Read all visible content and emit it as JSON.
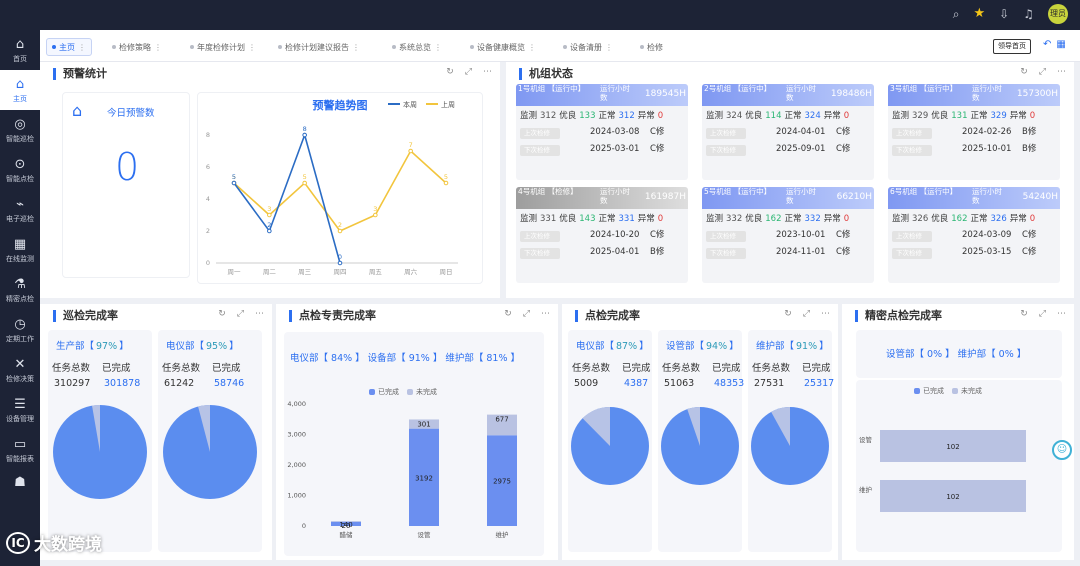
{
  "topbar": {
    "icons": [
      "search-icon",
      "star-icon",
      "download-icon",
      "bell-icon"
    ],
    "avatar_text": "理员"
  },
  "sidebar": {
    "items": [
      {
        "label": "首页",
        "icon": "home-icon",
        "glyph": "⌂"
      },
      {
        "label": "主页",
        "icon": "home-filled-icon",
        "glyph": "⌂",
        "active": true
      },
      {
        "label": "智能巡检",
        "icon": "patrol-icon",
        "glyph": "◎"
      },
      {
        "label": "智能点检",
        "icon": "spot-check-icon",
        "glyph": "⊙"
      },
      {
        "label": "电子巡检",
        "icon": "pulse-icon",
        "glyph": "⌁"
      },
      {
        "label": "在线监测",
        "icon": "monitor-icon",
        "glyph": "▦"
      },
      {
        "label": "精密点检",
        "icon": "precision-icon",
        "glyph": "⚗"
      },
      {
        "label": "定期工作",
        "icon": "clock-icon",
        "glyph": "◷"
      },
      {
        "label": "检修决策",
        "icon": "wrench-icon",
        "glyph": "✕"
      },
      {
        "label": "设备管理",
        "icon": "device-icon",
        "glyph": "☰"
      },
      {
        "label": "智能报表",
        "icon": "report-icon",
        "glyph": "▭"
      },
      {
        "label": "",
        "icon": "gamepad-icon",
        "glyph": "☗"
      }
    ]
  },
  "tabs": [
    {
      "label": "主页",
      "active": true
    },
    {
      "label": "检修策略"
    },
    {
      "label": "年度检修计划"
    },
    {
      "label": "检修计划建议报告"
    },
    {
      "label": "系统总览"
    },
    {
      "label": "设备健康概览"
    },
    {
      "label": "设备清册"
    },
    {
      "label": "检修"
    }
  ],
  "leader_button": "领导首页",
  "colors": {
    "accent": "#2c6ff0",
    "sidebar_bg": "#1d2336",
    "this_week": "#2b6cc4",
    "last_week": "#f2c53d",
    "done": "#6b8ff0",
    "undone": "#b9c2e2"
  },
  "alarm": {
    "title": "预警统计",
    "today_label": "今日预警数",
    "today_value": "0",
    "trend_title": "预警趋势图",
    "legend_this_week": "本周",
    "legend_last_week": "上周"
  },
  "chart_data": [
    {
      "type": "line",
      "title": "预警趋势图",
      "categories": [
        "周一",
        "周二",
        "周三",
        "周四",
        "周五",
        "周六",
        "周日"
      ],
      "ylim": [
        0,
        8
      ],
      "yticks": [
        0,
        2,
        4,
        6,
        8
      ],
      "series": [
        {
          "name": "本周",
          "values": [
            5,
            2,
            8,
            0,
            null,
            null,
            null
          ]
        },
        {
          "name": "上周",
          "values": [
            5,
            3,
            5,
            2,
            3,
            7,
            5
          ]
        }
      ]
    },
    {
      "type": "pie",
      "title": "巡检完成率 生产部",
      "values": [
        {
          "label": "已完成",
          "value": 301878
        },
        {
          "label": "未完成",
          "value": 8419
        }
      ]
    },
    {
      "type": "pie",
      "title": "巡检完成率 电仪部",
      "values": [
        {
          "label": "已完成",
          "value": 58746
        },
        {
          "label": "未完成",
          "value": 2496
        }
      ]
    },
    {
      "type": "bar",
      "title": "点检专责完成率",
      "categories": [
        "醋储",
        "设管",
        "维护"
      ],
      "ylim": [
        0,
        4000
      ],
      "yticks": [
        "0",
        "1,000",
        "2,000",
        "3,000",
        "4,000"
      ],
      "stacked": true,
      "series": [
        {
          "name": "已完成",
          "values": [
            140,
            3192,
            2975
          ]
        },
        {
          "name": "未完成",
          "values": [
            20,
            301,
            677
          ]
        }
      ]
    },
    {
      "type": "pie",
      "title": "点检完成率 电仪部",
      "values": [
        {
          "label": "已完成",
          "value": 4387
        },
        {
          "label": "未完成",
          "value": 622
        }
      ]
    },
    {
      "type": "pie",
      "title": "点检完成率 设管部",
      "values": [
        {
          "label": "已完成",
          "value": 48353
        },
        {
          "label": "未完成",
          "value": 2710
        }
      ]
    },
    {
      "type": "pie",
      "title": "点检完成率 维护部",
      "values": [
        {
          "label": "已完成",
          "value": 25317
        },
        {
          "label": "未完成",
          "value": 2214
        }
      ]
    },
    {
      "type": "bar",
      "orientation": "horizontal",
      "title": "精密点检完成率",
      "categories": [
        "设管",
        "维护"
      ],
      "stacked": true,
      "series": [
        {
          "name": "已完成",
          "values": [
            0,
            0
          ]
        },
        {
          "name": "未完成",
          "values": [
            102,
            102
          ]
        }
      ]
    }
  ],
  "units": {
    "title": "机组状态",
    "items": [
      {
        "name": "1号机组 【运行中】",
        "hours_label": "运行小时数",
        "hours": "189545H",
        "status": "blue",
        "monitor": "312",
        "good": "133",
        "normal": "312",
        "abnormal": "0",
        "last_label": "上次检修",
        "last_date": "2024-03-08",
        "last_class": "C修",
        "next_label": "下次检修",
        "next_date": "2025-03-01",
        "next_class": "C修"
      },
      {
        "name": "2号机组 【运行中】",
        "hours_label": "运行小时数",
        "hours": "198486H",
        "status": "blue",
        "monitor": "324",
        "good": "114",
        "normal": "324",
        "abnormal": "0",
        "last_label": "上次检修",
        "last_date": "2024-04-01",
        "last_class": "C修",
        "next_label": "下次检修",
        "next_date": "2025-09-01",
        "next_class": "C修"
      },
      {
        "name": "3号机组 【运行中】",
        "hours_label": "运行小时数",
        "hours": "157300H",
        "status": "blue",
        "monitor": "329",
        "good": "131",
        "normal": "329",
        "abnormal": "0",
        "last_label": "上次检修",
        "last_date": "2024-02-26",
        "last_class": "B修",
        "next_label": "下次检修",
        "next_date": "2025-10-01",
        "next_class": "B修"
      },
      {
        "name": "4号机组 【检修】",
        "hours_label": "运行小时数",
        "hours": "161987H",
        "status": "gray",
        "monitor": "331",
        "good": "143",
        "normal": "331",
        "abnormal": "0",
        "last_label": "上次检修",
        "last_date": "2024-10-20",
        "last_class": "C修",
        "next_label": "下次检修",
        "next_date": "2025-04-01",
        "next_class": "B修"
      },
      {
        "name": "5号机组 【运行中】",
        "hours_label": "运行小时数",
        "hours": "66210H",
        "status": "blue",
        "monitor": "332",
        "good": "162",
        "normal": "332",
        "abnormal": "0",
        "last_label": "上次检修",
        "last_date": "2023-10-01",
        "last_class": "C修",
        "next_label": "下次检修",
        "next_date": "2024-11-01",
        "next_class": "C修"
      },
      {
        "name": "6号机组 【运行中】",
        "hours_label": "运行小时数",
        "hours": "54240H",
        "status": "blue",
        "monitor": "326",
        "good": "162",
        "normal": "326",
        "abnormal": "0",
        "last_label": "上次检修",
        "last_date": "2024-03-09",
        "last_class": "C修",
        "next_label": "下次检修",
        "next_date": "2025-03-15",
        "next_class": "C修"
      }
    ],
    "lbl_monitor": "监测",
    "lbl_good": "优良",
    "lbl_normal": "正常",
    "lbl_abnormal": "异常"
  },
  "patrol": {
    "title": "巡检完成率",
    "lbl_total": "任务总数",
    "lbl_done": "已完成",
    "depts": [
      {
        "name": "生产部【",
        "pct": "97%",
        "close": "】",
        "total": "310297",
        "done": "301878"
      },
      {
        "name": "电仪部【",
        "pct": "95%",
        "close": "】",
        "total": "61242",
        "done": "58746"
      }
    ]
  },
  "special": {
    "title": "点检专责完成率",
    "summary": "电仪部【 84% 】 设备部【 91% 】 维护部【 81% 】",
    "legend_done": "已完成",
    "legend_undone": "未完成"
  },
  "spot": {
    "title": "点检完成率",
    "lbl_total": "任务总数",
    "lbl_done": "已完成",
    "depts": [
      {
        "name": "电仪部【",
        "pct": "87%",
        "close": "】",
        "total": "5009",
        "done": "4387"
      },
      {
        "name": "设管部【",
        "pct": "94%",
        "close": "】",
        "total": "51063",
        "done": "48353"
      },
      {
        "name": "维护部【",
        "pct": "91%",
        "close": "】",
        "total": "27531",
        "done": "25317"
      }
    ]
  },
  "precision": {
    "title": "精密点检完成率",
    "summary": "设管部【 0% 】 维护部【 0% 】",
    "legend_done": "已完成",
    "legend_undone": "未完成"
  },
  "watermark": {
    "logo": "IC",
    "text": "大数跨境"
  }
}
